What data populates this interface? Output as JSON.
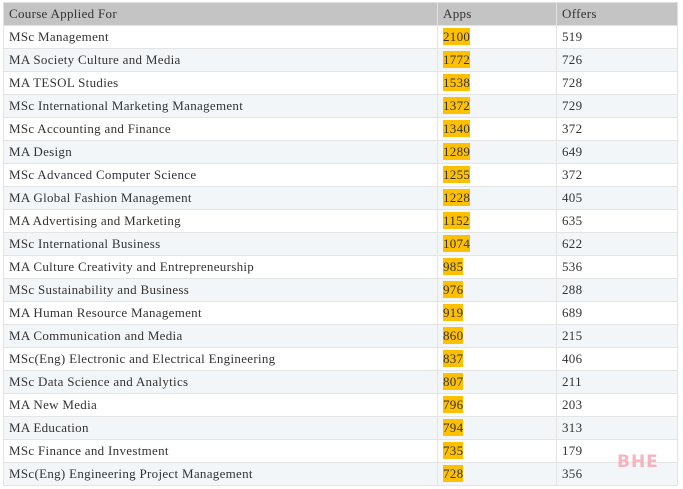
{
  "table": {
    "headers": {
      "course": "Course Applied For",
      "apps": "Apps",
      "offers": "Offers"
    },
    "rows": [
      {
        "course": "MSc Management",
        "apps": "2100",
        "offers": "519"
      },
      {
        "course": "MA Society Culture and Media",
        "apps": "1772",
        "offers": "726"
      },
      {
        "course": "MA TESOL Studies",
        "apps": "1538",
        "offers": "728"
      },
      {
        "course": "MSc International Marketing Management",
        "apps": "1372",
        "offers": "729"
      },
      {
        "course": "MSc Accounting and Finance",
        "apps": "1340",
        "offers": "372"
      },
      {
        "course": "MA Design",
        "apps": "1289",
        "offers": "649"
      },
      {
        "course": "MSc Advanced Computer Science",
        "apps": "1255",
        "offers": "372"
      },
      {
        "course": "MA Global Fashion Management",
        "apps": "1228",
        "offers": "405"
      },
      {
        "course": "MA Advertising and Marketing",
        "apps": "1152",
        "offers": "635"
      },
      {
        "course": "MSc International Business",
        "apps": "1074",
        "offers": "622"
      },
      {
        "course": "MA Culture Creativity and Entrepreneurship",
        "apps": "985",
        "offers": "536"
      },
      {
        "course": "MSc Sustainability and Business",
        "apps": "976",
        "offers": "288"
      },
      {
        "course": "MA Human Resource Management",
        "apps": "919",
        "offers": "689"
      },
      {
        "course": "MA Communication and Media",
        "apps": "860",
        "offers": "215"
      },
      {
        "course": "MSc(Eng) Electronic and Electrical Engineering",
        "apps": "837",
        "offers": "406"
      },
      {
        "course": "MSc Data Science and Analytics",
        "apps": "807",
        "offers": "211"
      },
      {
        "course": "MA New Media",
        "apps": "796",
        "offers": "203"
      },
      {
        "course": "MA Education",
        "apps": "794",
        "offers": "313"
      },
      {
        "course": "MSc Finance and Investment",
        "apps": "735",
        "offers": "179"
      },
      {
        "course": "MSc(Eng) Engineering Project Management",
        "apps": "728",
        "offers": "356"
      }
    ]
  },
  "watermark": "BHE",
  "colors": {
    "header_bg": "#c4c4c4",
    "highlight": "#ffc000",
    "stripe": "#f3f6f9",
    "watermark": "#f5a8b6"
  }
}
